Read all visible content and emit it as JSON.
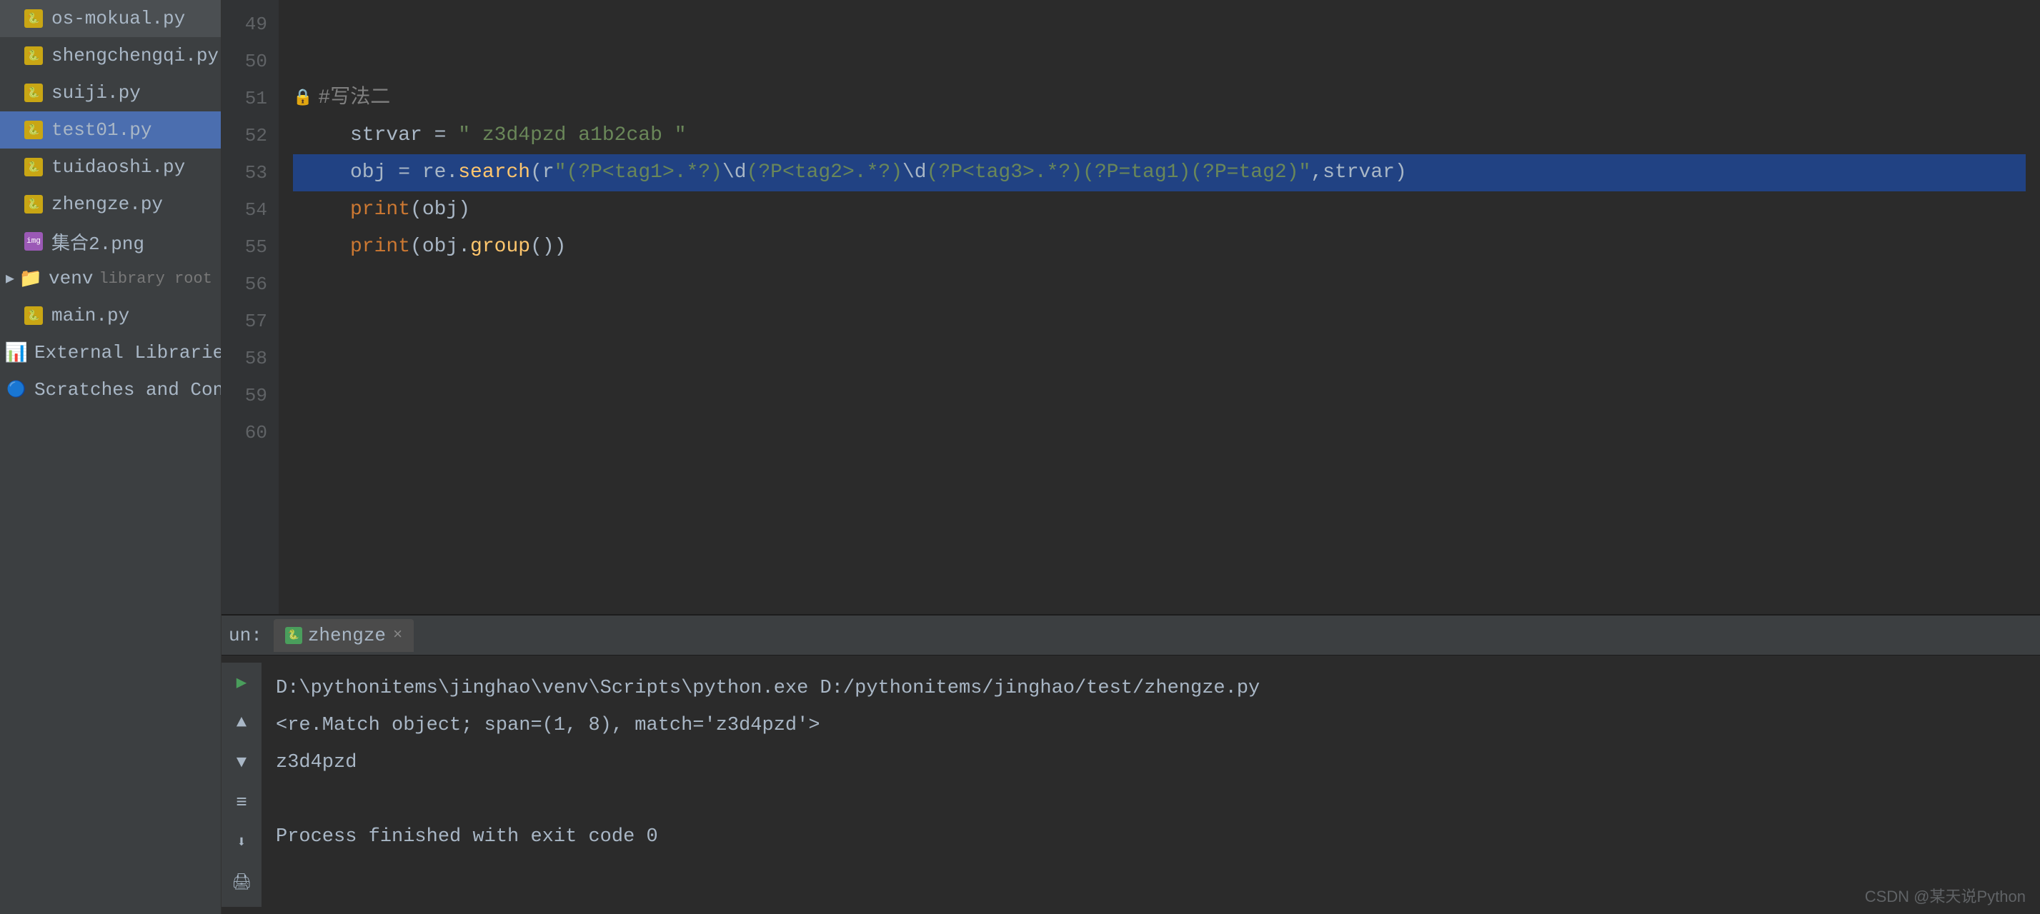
{
  "sidebar": {
    "items": [
      {
        "id": "os-mokual",
        "label": "os-mokual.py",
        "type": "py",
        "indent": 1
      },
      {
        "id": "shengchengqi",
        "label": "shengchengqi.py",
        "type": "py",
        "indent": 1
      },
      {
        "id": "suiji",
        "label": "suiji.py",
        "type": "py",
        "indent": 1
      },
      {
        "id": "test01",
        "label": "test01.py",
        "type": "py",
        "indent": 1,
        "active": true
      },
      {
        "id": "tuidaoshi",
        "label": "tuidaoshi.py",
        "type": "py",
        "indent": 1
      },
      {
        "id": "zhengze",
        "label": "zhengze.py",
        "type": "py",
        "indent": 1
      },
      {
        "id": "jicheng2",
        "label": "集合2.png",
        "type": "png",
        "indent": 1
      },
      {
        "id": "venv",
        "label": "venv",
        "type": "folder",
        "indent": 0,
        "extra": "library root"
      },
      {
        "id": "main",
        "label": "main.py",
        "type": "py",
        "indent": 1
      },
      {
        "id": "external-libraries",
        "label": "External Libraries",
        "type": "libraries",
        "indent": 0
      },
      {
        "id": "scratches",
        "label": "Scratches and Consoles",
        "type": "scratches",
        "indent": 0
      }
    ]
  },
  "editor": {
    "lines": [
      {
        "num": 49,
        "content": ""
      },
      {
        "num": 50,
        "content": ""
      },
      {
        "num": 51,
        "content": "  #写法二",
        "type": "comment-fold"
      },
      {
        "num": 52,
        "content": "    strvar = \" z3d4pzd a1b2cab \"",
        "type": "assignment"
      },
      {
        "num": 53,
        "content": "    obj = re.search(r\"(?P<tag1>.*?)\\d(?P<tag2>.*?)\\d(?P<tag3>.*?)(?P=tag1)(?P=tag2)\",strvar)",
        "type": "code",
        "highlight": true
      },
      {
        "num": 54,
        "content": "    print(obj)",
        "type": "code"
      },
      {
        "num": 55,
        "content": "    print(obj.group())",
        "type": "code"
      },
      {
        "num": 56,
        "content": ""
      },
      {
        "num": 57,
        "content": ""
      },
      {
        "num": 58,
        "content": ""
      },
      {
        "num": 59,
        "content": ""
      },
      {
        "num": 60,
        "content": ""
      }
    ]
  },
  "bottom_panel": {
    "run_label": "un:",
    "tab_label": "zhengze",
    "tab_close": "×",
    "console_lines": [
      {
        "text": "D:\\pythonitems\\jinghao\\venv\\Scripts\\python.exe D:/pythonitems/jinghao/test/zhengze.py",
        "type": "cmd"
      },
      {
        "text": "<re.Match object; span=(1, 8), match='z3d4pzd'>",
        "type": "output"
      },
      {
        "text": "z3d4pzd",
        "type": "result"
      },
      {
        "text": "",
        "type": "blank"
      },
      {
        "text": "Process finished with exit code 0",
        "type": "output"
      }
    ]
  },
  "watermark": {
    "text": "CSDN @某天说Python"
  },
  "icons": {
    "up_arrow": "▲",
    "down_arrow": "▼",
    "rerun": "↺",
    "stop": "■",
    "trash": "🗑"
  }
}
